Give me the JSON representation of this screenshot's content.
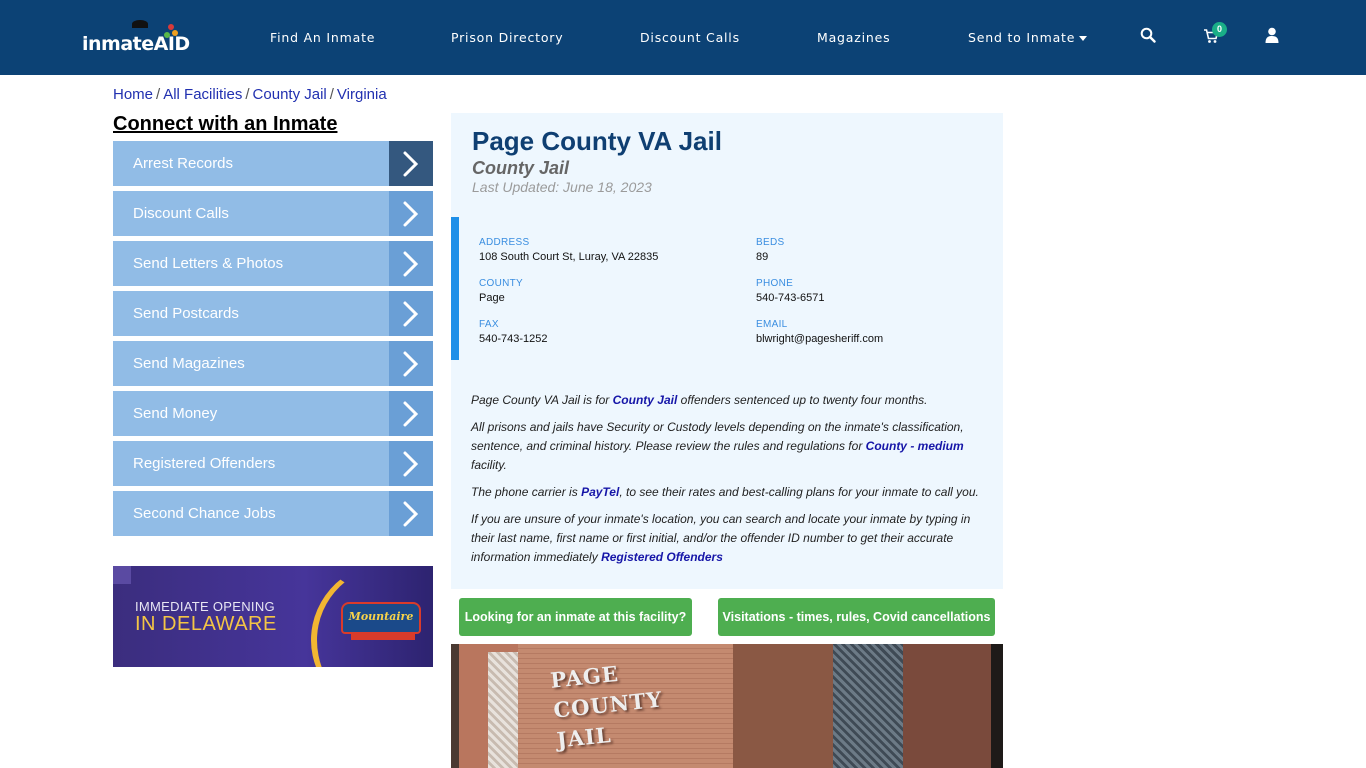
{
  "header": {
    "logo_text": "inmateAID",
    "nav": [
      {
        "label": "Find An Inmate"
      },
      {
        "label": "Prison Directory"
      },
      {
        "label": "Discount Calls"
      },
      {
        "label": "Magazines"
      },
      {
        "label": "Send to Inmate",
        "has_dropdown": true
      }
    ],
    "icons": [
      "search-icon",
      "cart-icon",
      "user-icon"
    ],
    "cart_count": "0"
  },
  "breadcrumb": [
    {
      "label": "Home"
    },
    {
      "label": "All Facilities"
    },
    {
      "label": "County Jail"
    },
    {
      "label": "Virginia"
    }
  ],
  "sidebar": {
    "title": "Connect with an Inmate",
    "items": [
      {
        "label": "Arrest Records"
      },
      {
        "label": "Discount Calls"
      },
      {
        "label": "Send Letters & Photos"
      },
      {
        "label": "Send Postcards"
      },
      {
        "label": "Send Magazines"
      },
      {
        "label": "Send Money"
      },
      {
        "label": "Registered Offenders"
      },
      {
        "label": "Second Chance Jobs"
      }
    ],
    "ad": {
      "line1": "IMMEDIATE OPENING",
      "line2": "IN DELAWARE",
      "brand": "Mountaire"
    }
  },
  "facility": {
    "name": "Page County VA Jail",
    "type": "County Jail",
    "last_updated": "Last Updated: June 18, 2023",
    "fields": {
      "address": {
        "label": "ADDRESS",
        "value": "108 South Court St, Luray, VA 22835"
      },
      "beds": {
        "label": "BEDS",
        "value": "89"
      },
      "county": {
        "label": "COUNTY",
        "value": "Page"
      },
      "phone": {
        "label": "PHONE",
        "value": "540-743-6571"
      },
      "fax": {
        "label": "FAX",
        "value": "540-743-1252"
      },
      "email": {
        "label": "EMAIL",
        "value": "blwright@pagesheriff.com"
      }
    },
    "description": {
      "p1_pre": "Page County VA Jail is for ",
      "p1_link": "County Jail",
      "p1_post": " offenders sentenced up to twenty four months.",
      "p2_pre": "All prisons and jails have Security or Custody levels depending on the inmate's classification, sentence, and criminal history. Please review the rules and regulations for ",
      "p2_link": "County - medium",
      "p2_post": " facility.",
      "p3_pre": "The phone carrier is ",
      "p3_link": "PayTel",
      "p3_post": ", to see their rates and best-calling plans for your inmate to call you.",
      "p4_pre": "If you are unsure of your inmate's location, you can search and locate your inmate by typing in their last name, first name or first initial, and/or the offender ID number to get their accurate information immediately ",
      "p4_link": "Registered Offenders"
    },
    "buttons": {
      "find_inmate": "Looking for an inmate at this facility?",
      "visitations": "Visitations - times, rules, Covid cancellations"
    },
    "photo_sign": [
      "PAGE",
      "COUNTY",
      "JAIL"
    ]
  },
  "colors": {
    "header_bg": "#0c4275",
    "sidebar_item": "#91bce6",
    "button_green": "#4eae50",
    "title_blue": "#0f3f72",
    "accent_blue": "#1e8fe8"
  }
}
